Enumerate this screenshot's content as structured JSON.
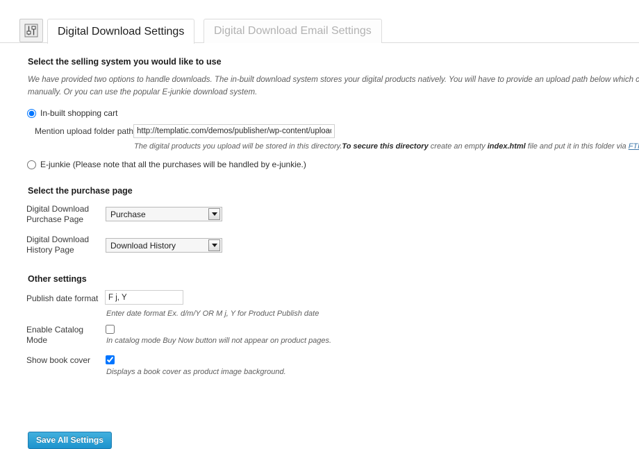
{
  "tabs": {
    "icon_name": "sliders-icon",
    "active": "Digital Download Settings",
    "inactive": "Digital Download Email Settings"
  },
  "selling_system": {
    "heading": "Select the selling system you would like to use",
    "description_line1": "We have provided two options to handle downloads. The in-built download system stores your digital products natively. You will have to provide an upload path below which can be secure",
    "description_line2": "manually. Or you can use the popular E-junkie download system.",
    "option_inbuilt": "In-built shopping cart",
    "option_ejunkie": "E-junkie (Please note that all the purchases will be handled by e-junkie.)",
    "selected": "inbuilt",
    "upload_path_label": "Mention upload folder path",
    "upload_path_value": "http://templatic.com/demos/publisher/wp-content/uploads/:",
    "upload_help_part1": "The digital products you upload will be stored in this directory.",
    "upload_help_bold1": "To secure this directory",
    "upload_help_part2": " create an empty ",
    "upload_help_bold2": "index.html",
    "upload_help_part3": " file and put it in this folder via ",
    "upload_help_link": "FTP"
  },
  "purchase_page": {
    "heading": "Select the purchase page",
    "purchase_label_line1": "Digital Download",
    "purchase_label_line2": "Purchase Page",
    "purchase_value": "Purchase",
    "history_label_line1": "Digital Download",
    "history_label_line2": "History Page",
    "history_value": "Download History"
  },
  "other_settings": {
    "heading": "Other settings",
    "date_format_label": "Publish date format",
    "date_format_value": "F j, Y",
    "date_format_help": "Enter date format Ex. d/m/Y OR M j, Y for Product Publish date",
    "catalog_label_line1": "Enable Catalog",
    "catalog_label_line2": "Mode",
    "catalog_checked": false,
    "catalog_help": "In catalog mode Buy Now button will not appear on product pages.",
    "bookcover_label": "Show book cover",
    "bookcover_checked": true,
    "bookcover_help": "Displays a book cover as product image background."
  },
  "footer": {
    "save_label": "Save All Settings"
  },
  "colors": {
    "accent": "#1d93cd",
    "link": "#3a75a8",
    "tab_active_text": "#1c1c1c",
    "tab_inactive_text": "#b2b2b2"
  }
}
